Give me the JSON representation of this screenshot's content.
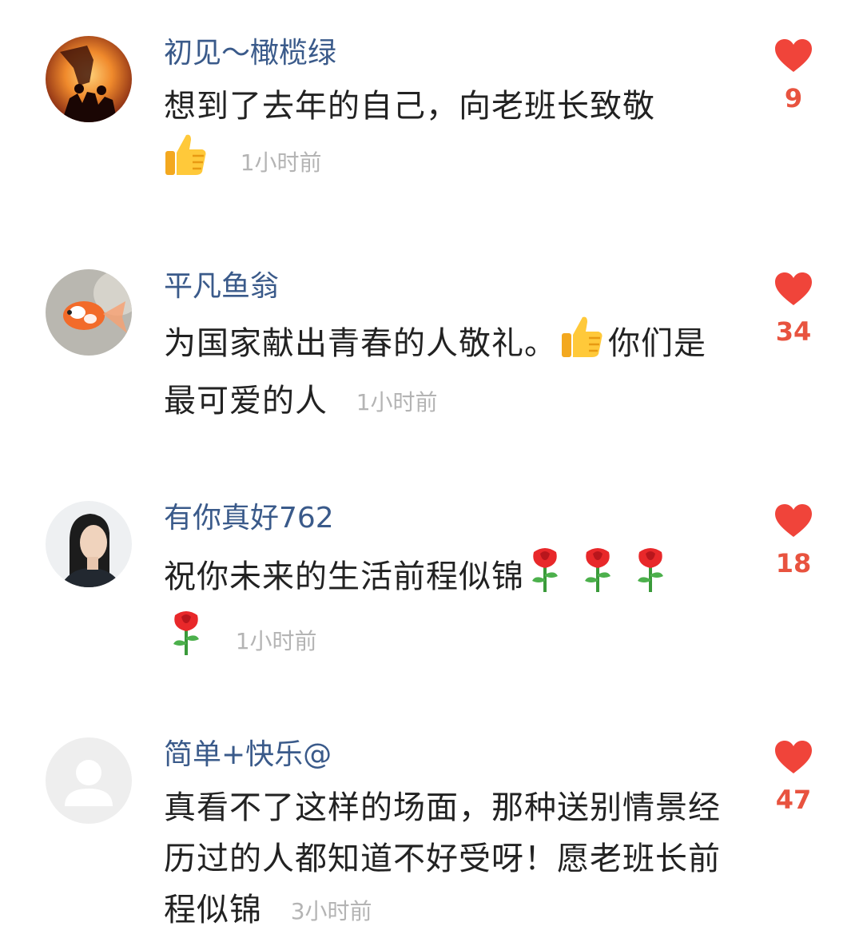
{
  "comments": [
    {
      "username": "初见～橄榄绿",
      "text": "想到了去年的自己，向老班长致敬",
      "emojis": [
        "thumbs-up"
      ],
      "time": "1小时前",
      "likes": "9",
      "avatar": "sunset-silhouette-avatar"
    },
    {
      "username": "平凡鱼翁",
      "text_before": "为国家献出青春的人敬礼。",
      "text_after": "你们是最可爱的人",
      "emojis": [
        "thumbs-up"
      ],
      "time": "1小时前",
      "likes": "34",
      "avatar": "goldfish-avatar"
    },
    {
      "username": "有你真好762",
      "text": "祝你未来的生活前程似锦",
      "emojis": [
        "rose",
        "rose",
        "rose",
        "rose"
      ],
      "time": "1小时前",
      "likes": "18",
      "avatar": "portrait-avatar"
    },
    {
      "username": "简单+快乐@",
      "text": "真看不了这样的场面，那种送别情景经历过的人都知道不好受呀！愿老班长前程似锦",
      "time": "3小时前",
      "likes": "47",
      "avatar": "default-avatar"
    }
  ],
  "colors": {
    "username": "#3a5a8a",
    "text": "#222222",
    "time": "#b4b4b4",
    "heart": "#f0443a",
    "count": "#e8533f"
  }
}
